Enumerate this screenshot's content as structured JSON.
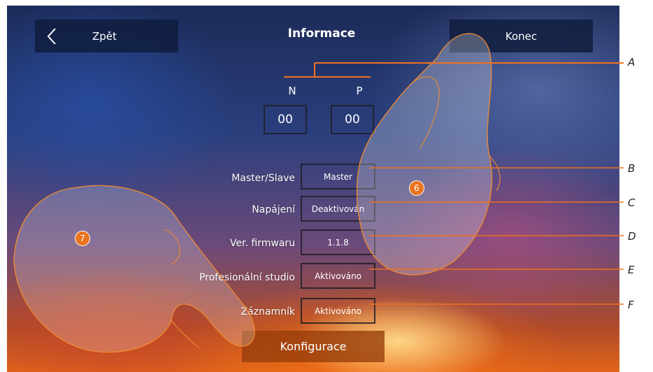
{
  "header": {
    "back_label": "Zpět",
    "title": "Informace",
    "end_label": "Konec"
  },
  "address": {
    "col_n": "N",
    "col_p": "P",
    "value_n": "00",
    "value_p": "00"
  },
  "rows": [
    {
      "label": "Master/Slave",
      "value": "Master",
      "callout": "B"
    },
    {
      "label": "Napájení",
      "value": "Deaktivován",
      "callout": "C"
    },
    {
      "label": "Ver. firmwaru",
      "value": "1.1.8",
      "callout": "D"
    },
    {
      "label": "Profesionální studio",
      "value": "Aktivováno",
      "callout": "E"
    },
    {
      "label": "Záznamník",
      "value": "Aktivováno",
      "callout": "F"
    }
  ],
  "callout_a": "A",
  "config_label": "Konfigurace",
  "steps": {
    "step6": "6",
    "step7": "7"
  },
  "icons": {
    "back": "chevron-left-icon",
    "hand": "pointing-hand-icon"
  },
  "colors": {
    "accent": "#e9741d",
    "panel": "#0f1c3c"
  }
}
